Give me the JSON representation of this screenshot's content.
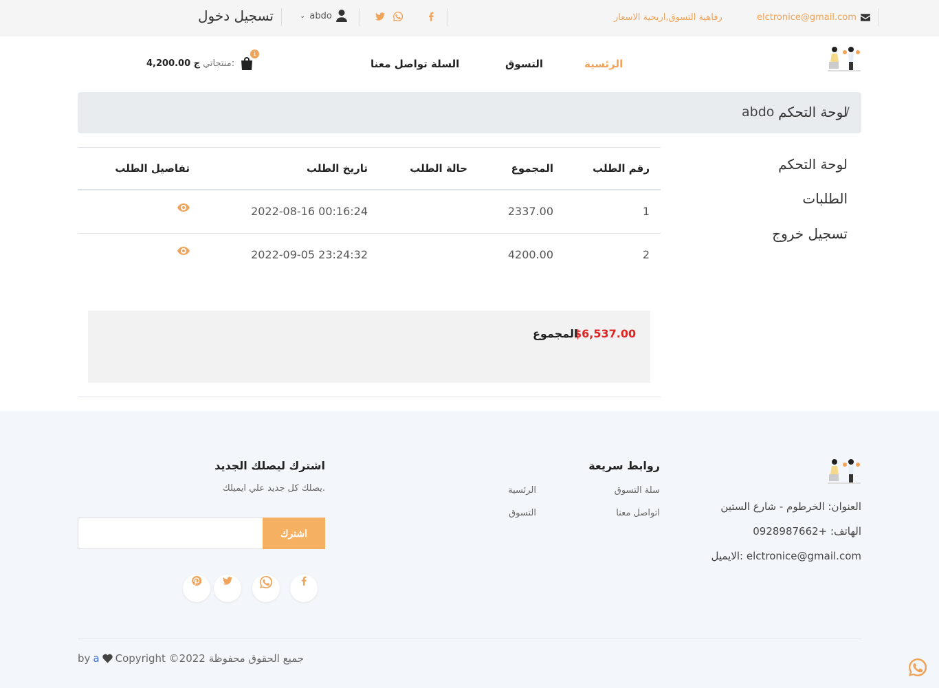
{
  "topbar": {
    "email": "elctronice@gmail.com",
    "slogan": "رفاهية التسوق,اريحية الاسعار",
    "user_name": "abdo",
    "login_label": "تسجيل دخول",
    "icons": [
      "envelope-icon",
      "facebook-icon",
      "whatsapp-icon",
      "twitter-icon",
      "user-icon",
      "chevron-down-icon"
    ]
  },
  "nav": {
    "home": "الرئسية",
    "shop": "التسوق",
    "cart_contact": "السلة تواصل معنا",
    "cart_total": "4,200.00 ج",
    "cart_label": "منتجاتي:",
    "cart_count": "1"
  },
  "breadcrumb": {
    "active": "لوحة التحكم",
    "separator": "/",
    "user": "abdo"
  },
  "sidebar": {
    "items": [
      {
        "label": "لوحة التحكم"
      },
      {
        "label": "الطلبات"
      },
      {
        "label": "تسجيل خروج"
      }
    ]
  },
  "orders": {
    "headers": {
      "number": "رقم الطلب",
      "total": "المجموع",
      "status": "حالة الطلب",
      "date": "تاريخ الطلب",
      "details": "تفاصيل الطلب"
    },
    "rows": [
      {
        "number": "1",
        "total": "2337.00",
        "status": "",
        "date": "2022-08-16 00:16:24"
      },
      {
        "number": "2",
        "total": "4200.00",
        "status": "",
        "date": "2022-09-05 23:24:32"
      }
    ],
    "grand_total_label": "المجموع",
    "grand_total": "$6,537.00"
  },
  "footer": {
    "address": "العنوان: الخرطوم - شارع الستين",
    "phone": "الهاتف: +0928987662",
    "email": "الايميل: elctronice@gmail.com",
    "links_title": "روابط سريعة",
    "links": {
      "cart": "سلة التسوق",
      "home": "الرئسية",
      "contact": "اتواصل معنا",
      "shop": "التسوق"
    },
    "subscribe_title": "اشترك ليصلك الجديد",
    "subscribe_text": "يصلك كل جديد علي ايميلك.",
    "subscribe_button": "اشترك",
    "subscribe_placeholder": "",
    "copyright": "Copyright ©2022 جميع الحقوق محفوظة",
    "by": "by",
    "author": "a"
  },
  "colors": {
    "accent": "#f0a35a",
    "total_red": "#e02424",
    "footer_bg": "#f3f6fa",
    "breadcrumb_bg": "#e9ecef"
  }
}
